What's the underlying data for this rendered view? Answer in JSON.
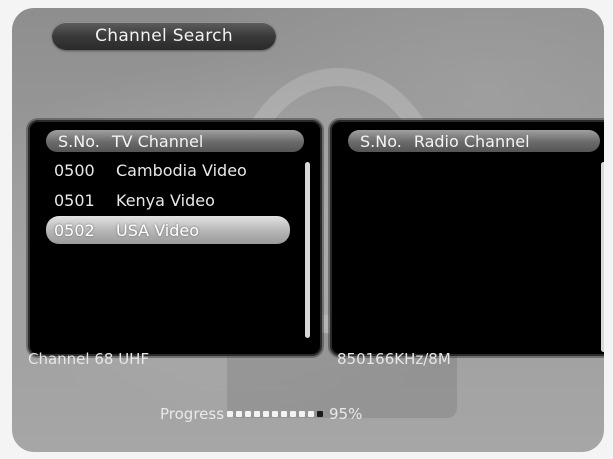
{
  "title": "Channel Search",
  "tv_panel": {
    "header_sno": "S.No.",
    "header_label": "TV Channel",
    "rows": [
      {
        "num": "0500",
        "name": "Cambodia Video",
        "selected": false
      },
      {
        "num": "0501",
        "name": "Kenya Video",
        "selected": false
      },
      {
        "num": "0502",
        "name": "USA Video",
        "selected": true
      }
    ]
  },
  "radio_panel": {
    "header_sno": "S.No.",
    "header_label": "Radio Channel",
    "rows": []
  },
  "status": {
    "channel": "Channel  68 UHF",
    "frequency": "850166KHz/8M"
  },
  "progress": {
    "label": "Progress",
    "percent_text": "95%",
    "filled_dots": 10,
    "total_dots": 11
  }
}
